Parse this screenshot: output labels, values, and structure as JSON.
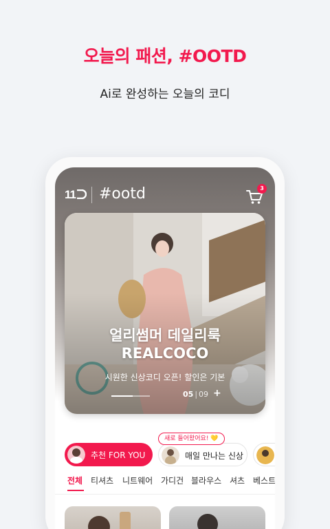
{
  "promo": {
    "headline": "오늘의 패션, #OOTD",
    "subline": "Ai로 완성하는 오늘의 코디"
  },
  "app": {
    "logo": "11",
    "title": "#ootd",
    "cart_badge": "3",
    "cart_icon": "cart-icon"
  },
  "banner": {
    "title_line1": "얼리썸머 데일리룩",
    "title_line2": "REALCOCO",
    "subtitle": "시원한 신상코디 오픈! 할인은 기본",
    "page_current": "05",
    "page_total": "09",
    "more_label": "+",
    "progress": 0.5556
  },
  "chips": {
    "recommend_label": "추천 FOR YOU",
    "new_tooltip": "새로 들어왔어요! 💛",
    "new_label": "매일 만나는 신상"
  },
  "tabs": [
    "전체",
    "티셔츠",
    "니트웨어",
    "가디건",
    "블라우스",
    "셔츠",
    "베스트"
  ],
  "colors": {
    "accent": "#f2194d",
    "background": "#f2f4f7"
  }
}
